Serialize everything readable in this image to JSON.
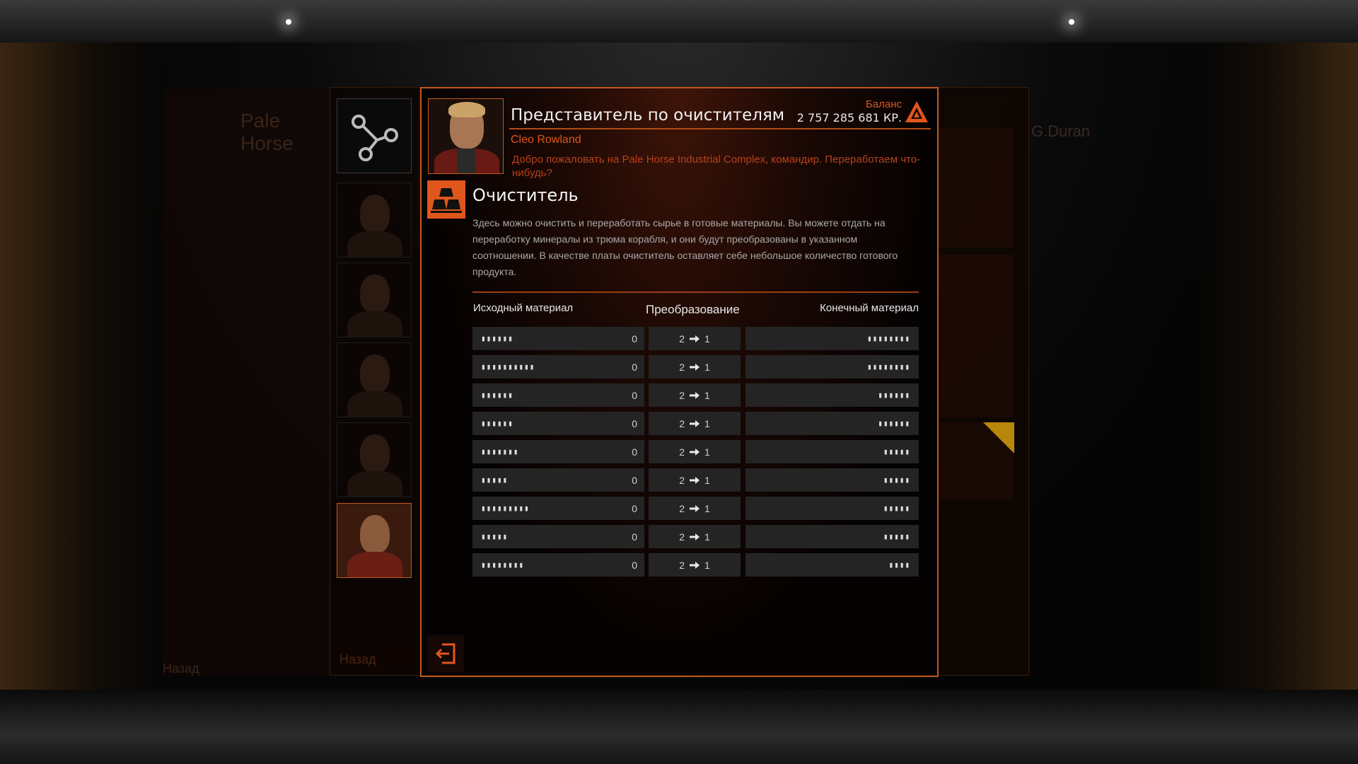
{
  "background": {
    "left_station_title": "Pale Horse",
    "left_back_ghost": "Назад",
    "right_player_name": "G.Duran"
  },
  "nav": {
    "back_label": "Назад"
  },
  "representative": {
    "title": "Представитель по очистителям",
    "name": "Cleo Rowland",
    "greeting": "Добро пожаловать на Pale Horse Industrial Complex, командир. Переработаем что-нибудь?"
  },
  "balance": {
    "label": "Баланс",
    "value": "2 757 285 681 КР."
  },
  "service": {
    "title": "Очиститель",
    "description": "Здесь можно очистить и переработать сырье в готовые материалы. Вы можете отдать на переработку минералы из трюма корабля, и они будут преобразованы в указанном соотношении. В качестве платы очиститель оставляет себе небольшое количество готового продукта."
  },
  "table": {
    "headers": {
      "source": "Исходный материал",
      "conversion": "Преобразование",
      "result": "Конечный материал"
    },
    "rows": [
      {
        "source": "▮▮▮▮▮▮",
        "qty": "0",
        "from": "2",
        "to": "1",
        "result": "▮▮▮▮▮▮▮▮"
      },
      {
        "source": "▮▮▮▮▮▮▮▮▮▮",
        "qty": "0",
        "from": "2",
        "to": "1",
        "result": "▮▮▮▮▮▮▮▮"
      },
      {
        "source": "▮▮▮▮▮▮",
        "qty": "0",
        "from": "2",
        "to": "1",
        "result": "▮▮▮▮▮▮"
      },
      {
        "source": "▮▮▮▮▮▮",
        "qty": "0",
        "from": "2",
        "to": "1",
        "result": "▮▮▮▮▮▮"
      },
      {
        "source": "▮▮▮▮▮▮▮",
        "qty": "0",
        "from": "2",
        "to": "1",
        "result": "▮▮▮▮▮"
      },
      {
        "source": "▮▮▮▮▮",
        "qty": "0",
        "from": "2",
        "to": "1",
        "result": "▮▮▮▮▮"
      },
      {
        "source": "▮▮▮▮▮▮▮▮▮",
        "qty": "0",
        "from": "2",
        "to": "1",
        "result": "▮▮▮▮▮"
      },
      {
        "source": "▮▮▮▮▮",
        "qty": "0",
        "from": "2",
        "to": "1",
        "result": "▮▮▮▮▮"
      },
      {
        "source": "▮▮▮▮▮▮▮▮",
        "qty": "0",
        "from": "2",
        "to": "1",
        "result": "▮▮▮▮"
      }
    ]
  },
  "icons": {
    "share": "share-nodes-icon",
    "service": "refinery-bars-icon",
    "balance": "credits-icon",
    "exit": "exit-icon",
    "arrow": "arrow-right-icon"
  },
  "colors": {
    "accent": "#e0561b",
    "panel_border": "#c2581b",
    "row_bg": "#242424"
  }
}
